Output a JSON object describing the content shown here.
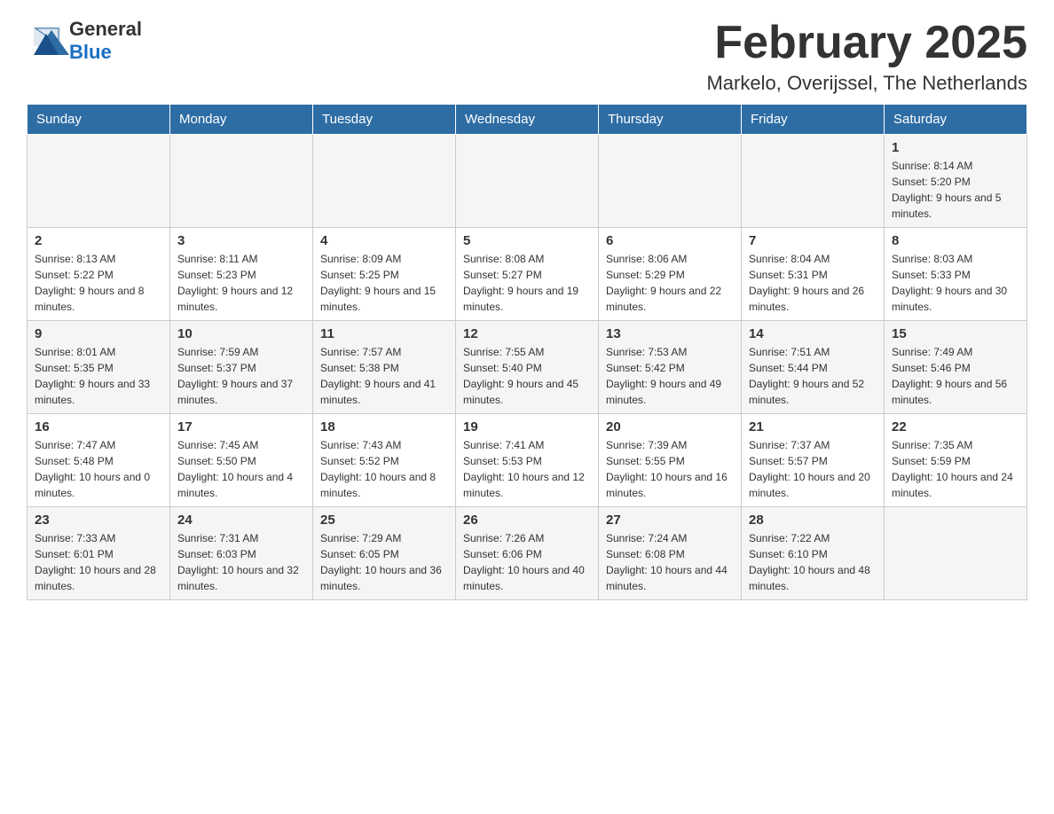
{
  "header": {
    "logo_general": "General",
    "logo_blue": "Blue",
    "month_title": "February 2025",
    "location": "Markelo, Overijssel, The Netherlands"
  },
  "days_of_week": [
    "Sunday",
    "Monday",
    "Tuesday",
    "Wednesday",
    "Thursday",
    "Friday",
    "Saturday"
  ],
  "weeks": [
    [
      {
        "day": "",
        "info": ""
      },
      {
        "day": "",
        "info": ""
      },
      {
        "day": "",
        "info": ""
      },
      {
        "day": "",
        "info": ""
      },
      {
        "day": "",
        "info": ""
      },
      {
        "day": "",
        "info": ""
      },
      {
        "day": "1",
        "info": "Sunrise: 8:14 AM\nSunset: 5:20 PM\nDaylight: 9 hours and 5 minutes."
      }
    ],
    [
      {
        "day": "2",
        "info": "Sunrise: 8:13 AM\nSunset: 5:22 PM\nDaylight: 9 hours and 8 minutes."
      },
      {
        "day": "3",
        "info": "Sunrise: 8:11 AM\nSunset: 5:23 PM\nDaylight: 9 hours and 12 minutes."
      },
      {
        "day": "4",
        "info": "Sunrise: 8:09 AM\nSunset: 5:25 PM\nDaylight: 9 hours and 15 minutes."
      },
      {
        "day": "5",
        "info": "Sunrise: 8:08 AM\nSunset: 5:27 PM\nDaylight: 9 hours and 19 minutes."
      },
      {
        "day": "6",
        "info": "Sunrise: 8:06 AM\nSunset: 5:29 PM\nDaylight: 9 hours and 22 minutes."
      },
      {
        "day": "7",
        "info": "Sunrise: 8:04 AM\nSunset: 5:31 PM\nDaylight: 9 hours and 26 minutes."
      },
      {
        "day": "8",
        "info": "Sunrise: 8:03 AM\nSunset: 5:33 PM\nDaylight: 9 hours and 30 minutes."
      }
    ],
    [
      {
        "day": "9",
        "info": "Sunrise: 8:01 AM\nSunset: 5:35 PM\nDaylight: 9 hours and 33 minutes."
      },
      {
        "day": "10",
        "info": "Sunrise: 7:59 AM\nSunset: 5:37 PM\nDaylight: 9 hours and 37 minutes."
      },
      {
        "day": "11",
        "info": "Sunrise: 7:57 AM\nSunset: 5:38 PM\nDaylight: 9 hours and 41 minutes."
      },
      {
        "day": "12",
        "info": "Sunrise: 7:55 AM\nSunset: 5:40 PM\nDaylight: 9 hours and 45 minutes."
      },
      {
        "day": "13",
        "info": "Sunrise: 7:53 AM\nSunset: 5:42 PM\nDaylight: 9 hours and 49 minutes."
      },
      {
        "day": "14",
        "info": "Sunrise: 7:51 AM\nSunset: 5:44 PM\nDaylight: 9 hours and 52 minutes."
      },
      {
        "day": "15",
        "info": "Sunrise: 7:49 AM\nSunset: 5:46 PM\nDaylight: 9 hours and 56 minutes."
      }
    ],
    [
      {
        "day": "16",
        "info": "Sunrise: 7:47 AM\nSunset: 5:48 PM\nDaylight: 10 hours and 0 minutes."
      },
      {
        "day": "17",
        "info": "Sunrise: 7:45 AM\nSunset: 5:50 PM\nDaylight: 10 hours and 4 minutes."
      },
      {
        "day": "18",
        "info": "Sunrise: 7:43 AM\nSunset: 5:52 PM\nDaylight: 10 hours and 8 minutes."
      },
      {
        "day": "19",
        "info": "Sunrise: 7:41 AM\nSunset: 5:53 PM\nDaylight: 10 hours and 12 minutes."
      },
      {
        "day": "20",
        "info": "Sunrise: 7:39 AM\nSunset: 5:55 PM\nDaylight: 10 hours and 16 minutes."
      },
      {
        "day": "21",
        "info": "Sunrise: 7:37 AM\nSunset: 5:57 PM\nDaylight: 10 hours and 20 minutes."
      },
      {
        "day": "22",
        "info": "Sunrise: 7:35 AM\nSunset: 5:59 PM\nDaylight: 10 hours and 24 minutes."
      }
    ],
    [
      {
        "day": "23",
        "info": "Sunrise: 7:33 AM\nSunset: 6:01 PM\nDaylight: 10 hours and 28 minutes."
      },
      {
        "day": "24",
        "info": "Sunrise: 7:31 AM\nSunset: 6:03 PM\nDaylight: 10 hours and 32 minutes."
      },
      {
        "day": "25",
        "info": "Sunrise: 7:29 AM\nSunset: 6:05 PM\nDaylight: 10 hours and 36 minutes."
      },
      {
        "day": "26",
        "info": "Sunrise: 7:26 AM\nSunset: 6:06 PM\nDaylight: 10 hours and 40 minutes."
      },
      {
        "day": "27",
        "info": "Sunrise: 7:24 AM\nSunset: 6:08 PM\nDaylight: 10 hours and 44 minutes."
      },
      {
        "day": "28",
        "info": "Sunrise: 7:22 AM\nSunset: 6:10 PM\nDaylight: 10 hours and 48 minutes."
      },
      {
        "day": "",
        "info": ""
      }
    ]
  ]
}
